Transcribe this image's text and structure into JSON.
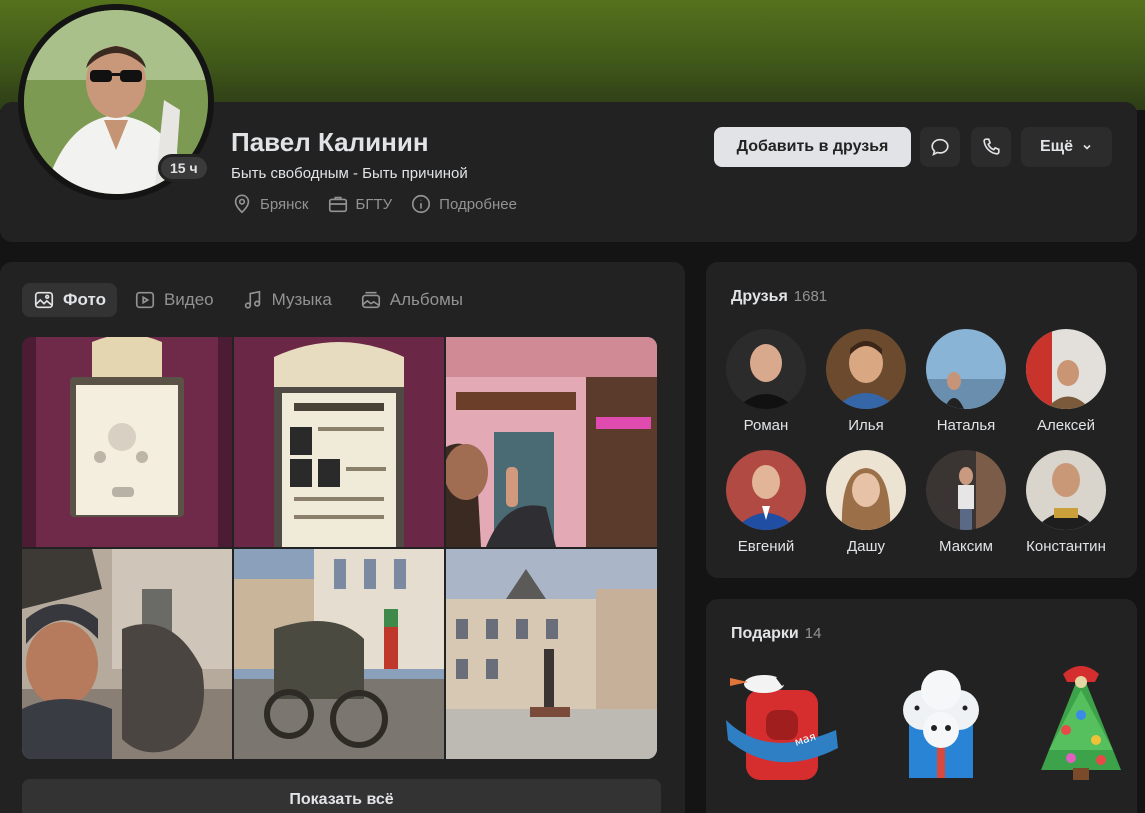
{
  "profile": {
    "name": "Павел Калинин",
    "status": "Быть свободным - Быть причиной",
    "online": "15 ч",
    "city": "Брянск",
    "university": "БГТУ",
    "details_label": "Подробнее"
  },
  "actions": {
    "add_friend": "Добавить в друзья",
    "more": "Ещё"
  },
  "media": {
    "tabs": [
      {
        "label": "Фото",
        "icon": "photo-icon",
        "active": true
      },
      {
        "label": "Видео",
        "icon": "video-icon",
        "active": false
      },
      {
        "label": "Музыка",
        "icon": "music-icon",
        "active": false
      },
      {
        "label": "Альбомы",
        "icon": "albums-icon",
        "active": false
      }
    ],
    "show_all": "Показать всё"
  },
  "friends": {
    "title": "Друзья",
    "count": "1681",
    "items": [
      {
        "name": "Роман"
      },
      {
        "name": "Илья"
      },
      {
        "name": "Наталья"
      },
      {
        "name": "Алексей"
      },
      {
        "name": "Евгений"
      },
      {
        "name": "Дашу"
      },
      {
        "name": "Максим"
      },
      {
        "name": "Константин"
      }
    ]
  },
  "gifts": {
    "title": "Подарки",
    "count": "14",
    "items": [
      {
        "label": "мая"
      }
    ]
  },
  "colors": {
    "cover": "#4e6a1d",
    "card": "#222222",
    "background": "#141414",
    "primary_button": "#e1e3e6"
  }
}
